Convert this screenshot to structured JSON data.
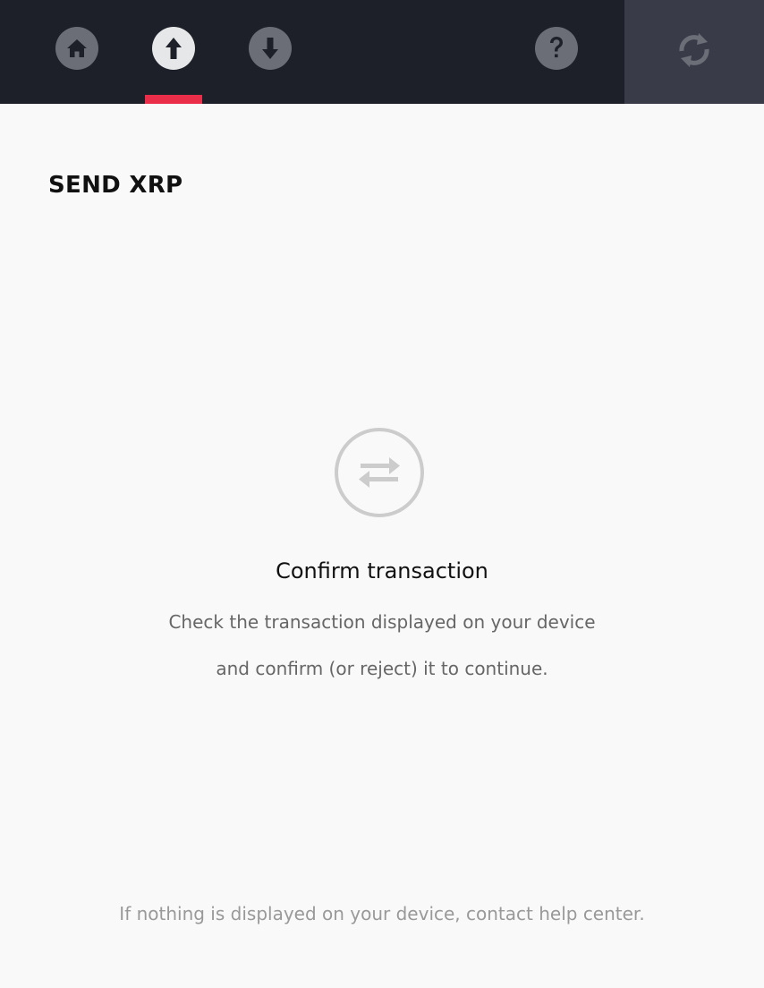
{
  "nav": {
    "items": [
      {
        "icon": "home-icon",
        "active": false
      },
      {
        "icon": "send-icon",
        "active": true
      },
      {
        "icon": "receive-icon",
        "active": false
      },
      {
        "icon": "help-icon",
        "active": false
      }
    ],
    "sync_icon": "sync-icon"
  },
  "page": {
    "title": "SEND XRP"
  },
  "confirm": {
    "icon": "transfer-arrows-icon",
    "heading": "Confirm transaction",
    "line1": "Check the transaction displayed on your device",
    "line2": "and confirm (or reject) it to continue."
  },
  "help": {
    "note": "If nothing is displayed on your device, contact help center."
  },
  "colors": {
    "topbar_bg": "#1d2028",
    "sync_panel_bg": "#393c48",
    "active_indicator": "#ea2e49",
    "page_bg": "#f9f9f9"
  }
}
